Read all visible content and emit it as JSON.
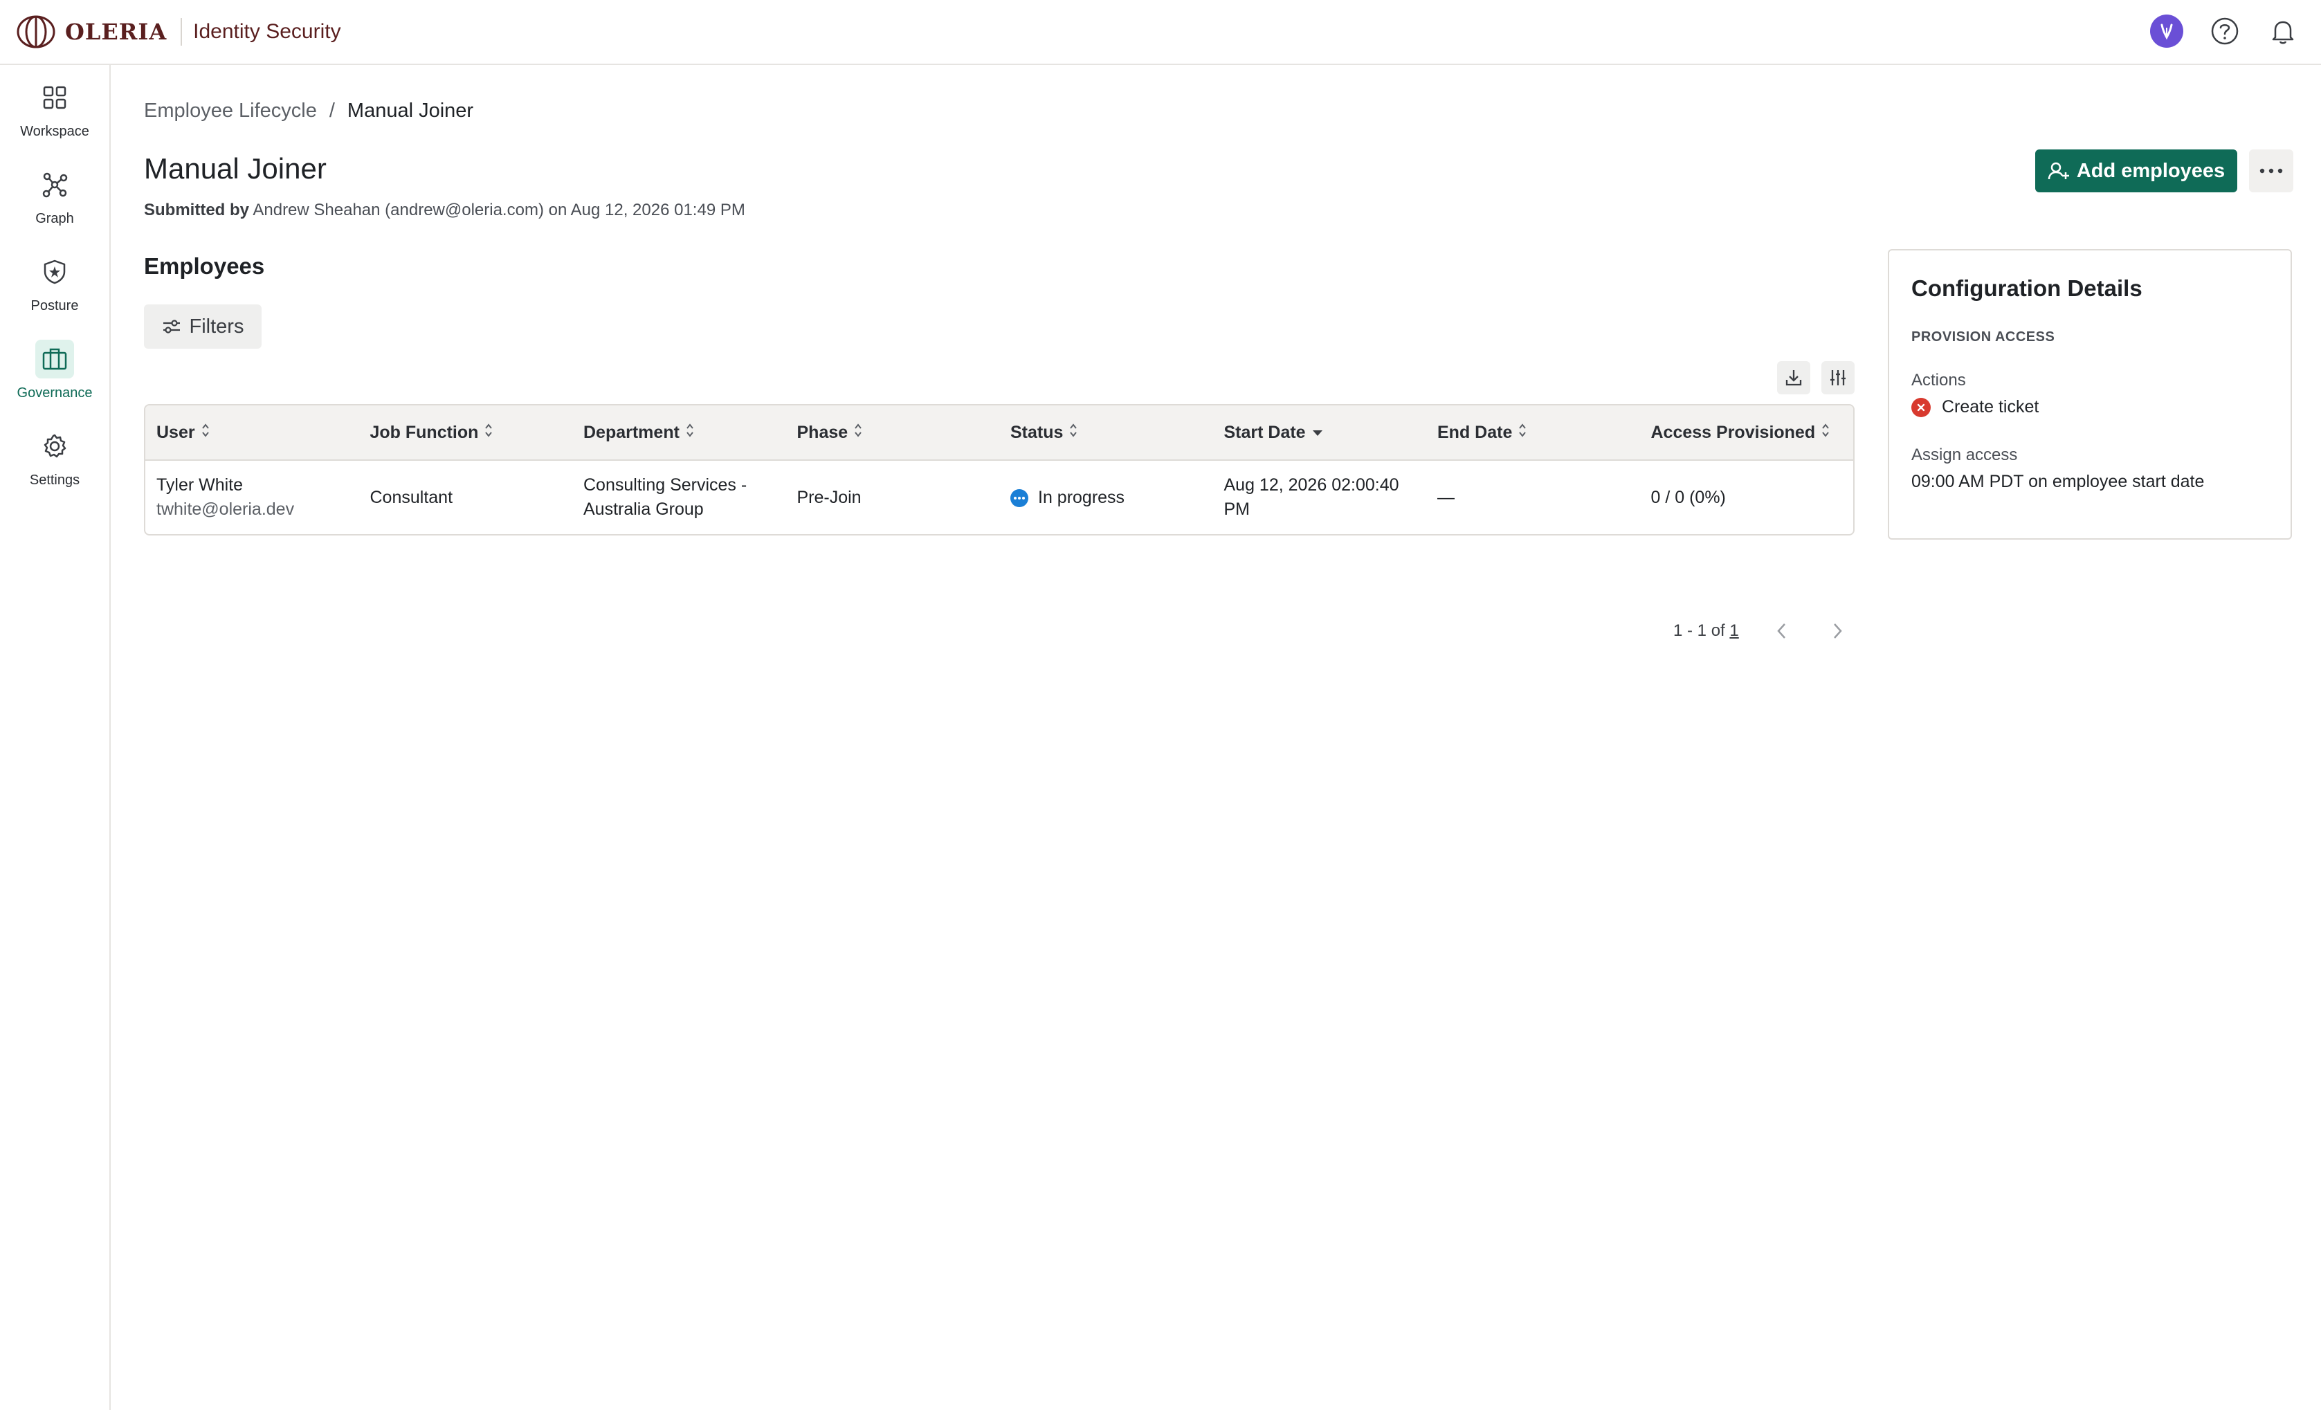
{
  "header": {
    "brand_name": "OLERIA",
    "product_name": "Identity Security",
    "icons": [
      "oleria-logo-icon",
      "assistant-icon",
      "help-icon",
      "bell-icon"
    ]
  },
  "sidebar": {
    "items": [
      {
        "label": "Workspace",
        "icon": "grid-icon",
        "active": false
      },
      {
        "label": "Graph",
        "icon": "graph-icon",
        "active": false
      },
      {
        "label": "Posture",
        "icon": "shield-star-icon",
        "active": false
      },
      {
        "label": "Governance",
        "icon": "briefcase-icon",
        "active": true
      },
      {
        "label": "Settings",
        "icon": "gear-icon",
        "active": false
      }
    ]
  },
  "breadcrumb": {
    "parent": "Employee Lifecycle",
    "separator": "/",
    "current": "Manual Joiner"
  },
  "page": {
    "title": "Manual Joiner",
    "submitted_label": "Submitted by",
    "submitted_text": "Andrew Sheahan (andrew@oleria.com) on Aug 12, 2026 01:49 PM",
    "add_button": "Add employees",
    "more_icon": "more-horizontal-icon"
  },
  "employees": {
    "title": "Employees",
    "filters_label": "Filters",
    "columns": [
      "User",
      "Job Function",
      "Department",
      "Phase",
      "Status",
      "Start Date",
      "End Date",
      "Access Provisioned"
    ],
    "sorted_column": "Start Date",
    "rows": [
      {
        "user_name": "Tyler White",
        "user_email": "twhite@oleria.dev",
        "job_function": "Consultant",
        "department_line1": "Consulting Services -",
        "department_line2": "Australia Group",
        "phase": "Pre-Join",
        "status": "In progress",
        "start_date_line1": "Aug 12, 2026 02:00:40",
        "start_date_line2": "PM",
        "end_date": "—",
        "access_provisioned": "0 / 0 (0%)"
      }
    ],
    "pagination": {
      "range": "1 - 1 of",
      "total": "1"
    }
  },
  "config": {
    "title": "Configuration Details",
    "section": "PROVISION ACCESS",
    "actions_label": "Actions",
    "action_item": "Create ticket",
    "assign_label": "Assign access",
    "assign_value": "09:00 AM PDT on employee start date"
  },
  "colors": {
    "accent": "#0f6b57",
    "active_bg": "#dff2ec",
    "status_blue": "#1a7fd6",
    "error_red": "#d83a2f",
    "brand": "#5a1f1f"
  }
}
